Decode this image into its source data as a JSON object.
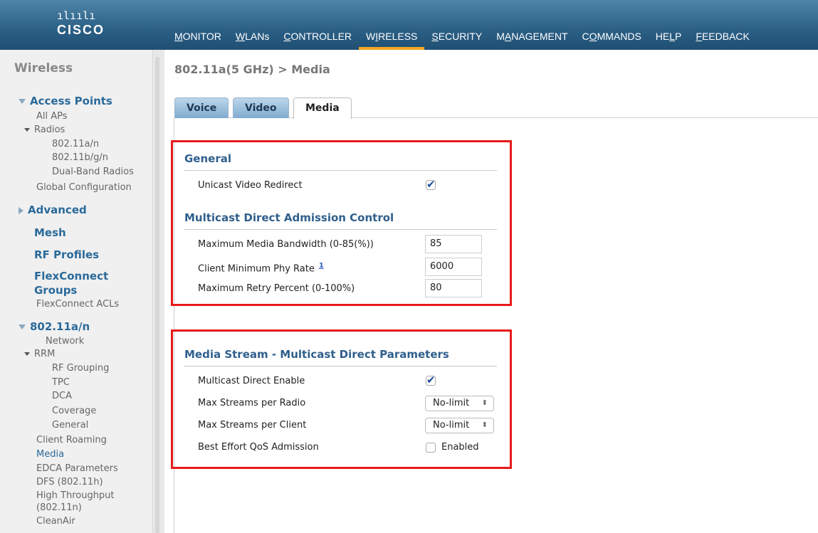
{
  "header": {
    "logo_bars": "ılıılı",
    "logo_text": "CISCO",
    "nav": [
      {
        "pre": "",
        "ul": "M",
        "post": "ONITOR"
      },
      {
        "pre": "",
        "ul": "W",
        "post": "LANs"
      },
      {
        "pre": "",
        "ul": "C",
        "post": "ONTROLLER"
      },
      {
        "pre": "W",
        "ul": "I",
        "post": "RELESS"
      },
      {
        "pre": "",
        "ul": "S",
        "post": "ECURITY"
      },
      {
        "pre": "M",
        "ul": "A",
        "post": "NAGEMENT"
      },
      {
        "pre": "C",
        "ul": "O",
        "post": "MMANDS"
      },
      {
        "pre": "HE",
        "ul": "L",
        "post": "P"
      },
      {
        "pre": "",
        "ul": "F",
        "post": "EEDBACK"
      }
    ],
    "active_nav": "WIRELESS",
    "accent_color": "#f5a623"
  },
  "sidebar": {
    "title": "Wireless",
    "access_points": "Access Points",
    "all_aps": "All APs",
    "radios": "Radios",
    "r_80211an": "802.11a/n",
    "r_80211bgn": "802.11b/g/n",
    "dual_band": "Dual-Band Radios",
    "global_config": "Global Configuration",
    "advanced": "Advanced",
    "mesh": "Mesh",
    "rf_profiles": "RF Profiles",
    "flexconnect_groups_1": "FlexConnect",
    "flexconnect_groups_2": "Groups",
    "flexconnect_acls": "FlexConnect ACLs",
    "band_80211an": "802.11a/n",
    "network": "Network",
    "rrm": "RRM",
    "rf_grouping": "RF Grouping",
    "tpc": "TPC",
    "dca": "DCA",
    "coverage": "Coverage",
    "general": "General",
    "client_roaming": "Client Roaming",
    "media": "Media",
    "edca": "EDCA Parameters",
    "dfs": "DFS (802.11h)",
    "high_throughput_1": "High Throughput",
    "high_throughput_2": "(802.11n)",
    "cleanair": "CleanAir"
  },
  "main": {
    "page_title": "802.11a(5 GHz) > Media",
    "tabs": [
      "Voice",
      "Video",
      "Media"
    ],
    "active_tab": "Media",
    "general": {
      "heading": "General",
      "unicast_video_redirect_label": "Unicast Video Redirect",
      "unicast_video_redirect_checked": true
    },
    "mdac": {
      "heading": "Multicast Direct Admission Control",
      "max_media_bw_label": "Maximum Media Bandwidth (0-85(%))",
      "max_media_bw_value": "85",
      "client_min_phy_label": "Client Minimum Phy Rate",
      "client_min_phy_footnote": "1",
      "client_min_phy_value": "6000",
      "max_retry_label": "Maximum Retry Percent (0-100%)",
      "max_retry_value": "80"
    },
    "media_stream": {
      "heading": "Media Stream - Multicast Direct Parameters",
      "multicast_direct_enable_label": "Multicast Direct Enable",
      "multicast_direct_enable_checked": true,
      "max_streams_radio_label": "Max Streams per Radio",
      "max_streams_radio_value": "No-limit",
      "max_streams_client_label": "Max Streams per Client",
      "max_streams_client_value": "No-limit",
      "best_effort_label": "Best Effort QoS Admission",
      "best_effort_enabled_label": "Enabled",
      "best_effort_checked": false
    },
    "highlight_color": "#e81a1a"
  }
}
